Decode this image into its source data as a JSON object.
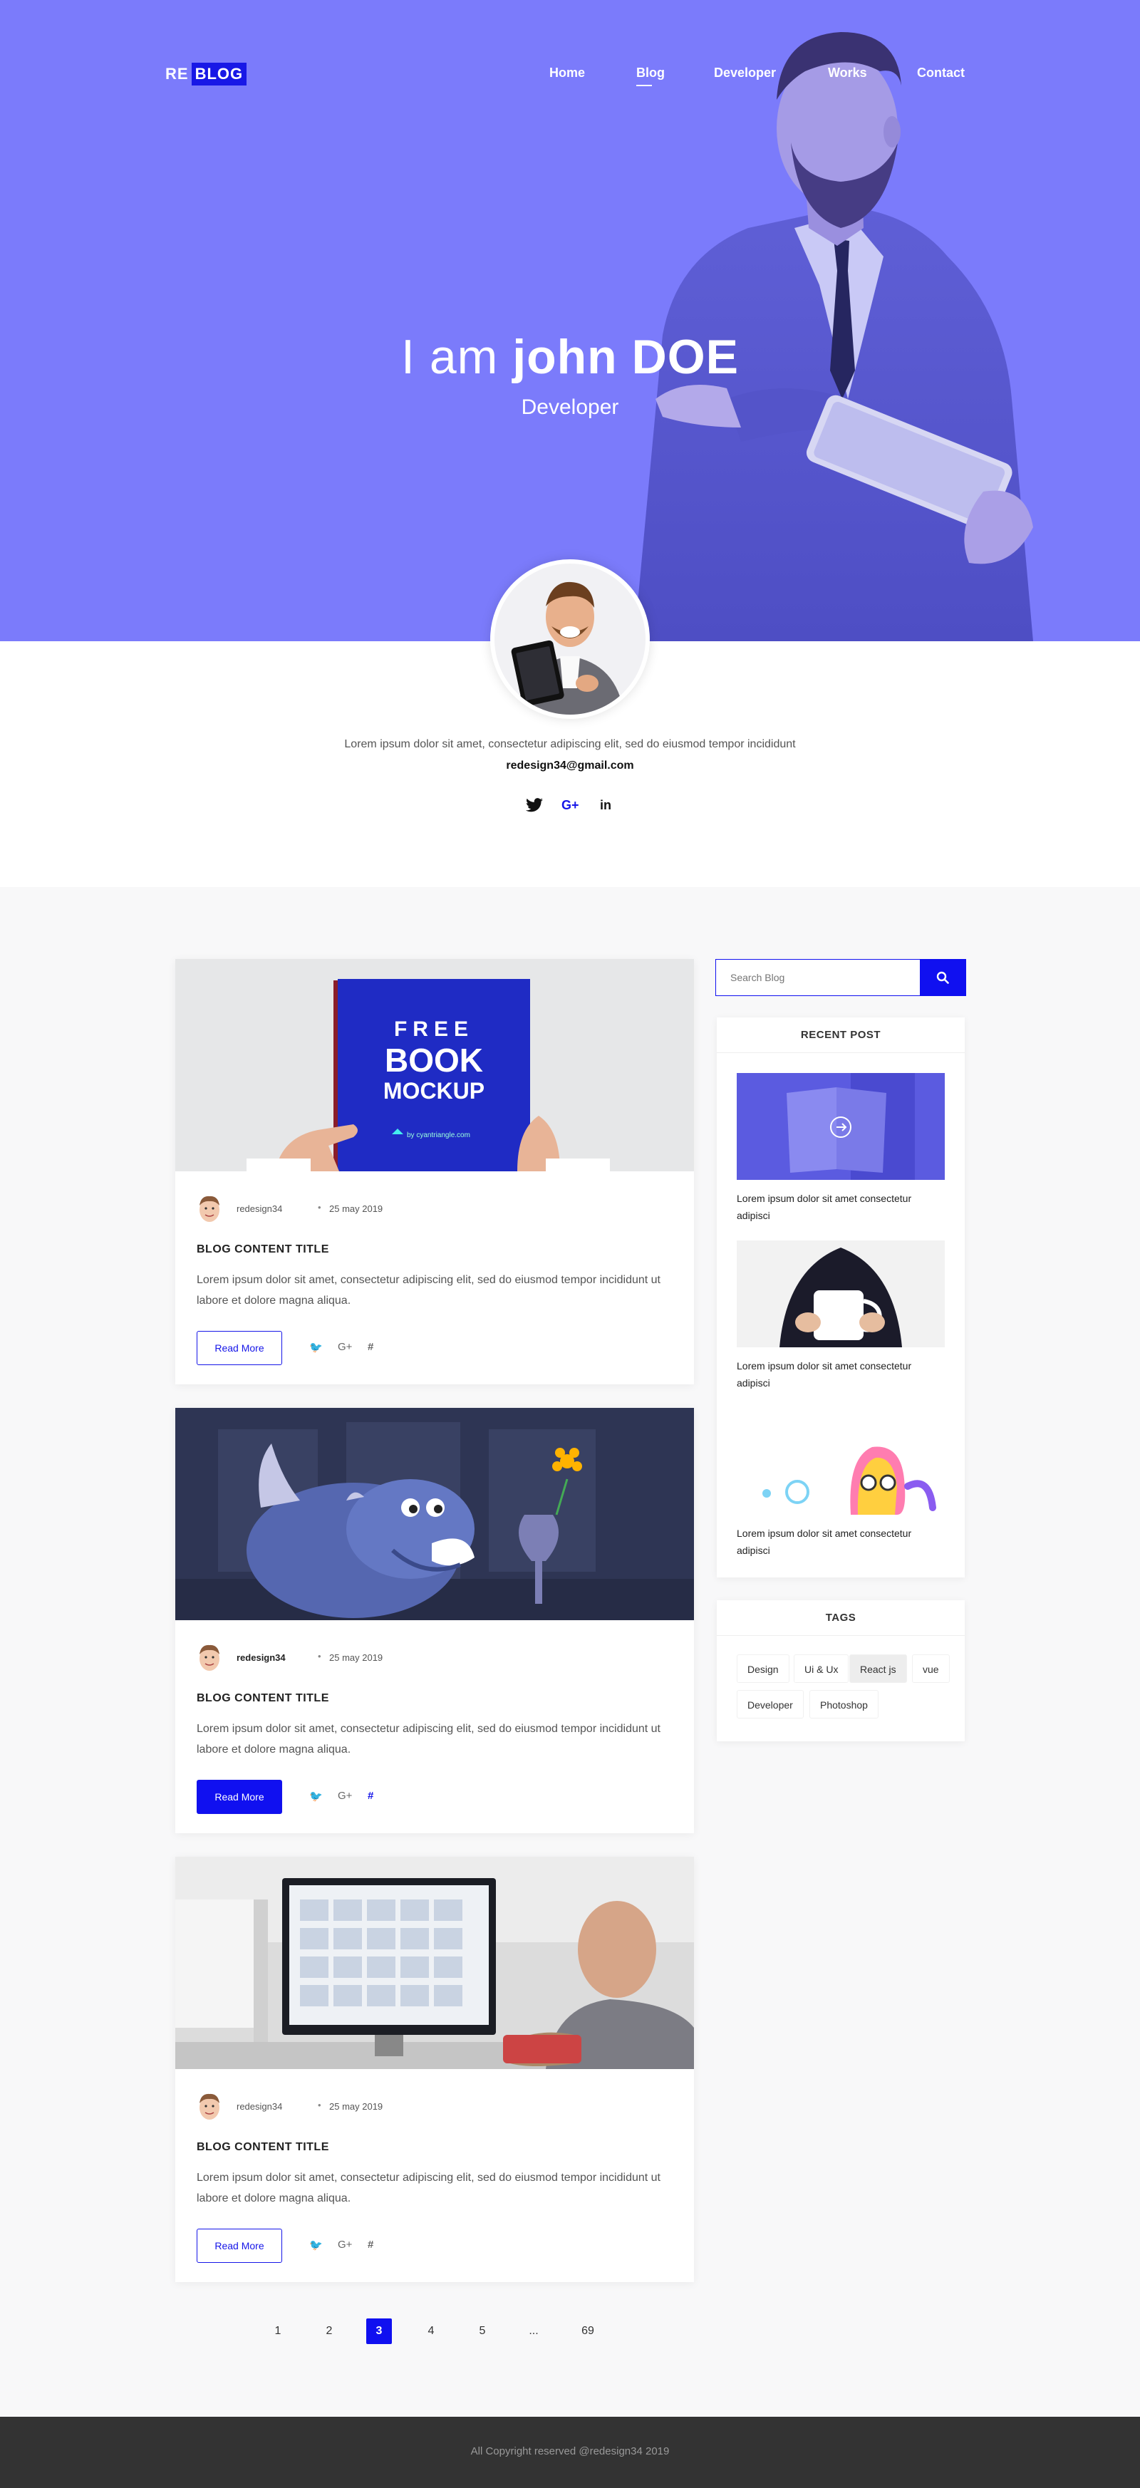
{
  "brand": {
    "logo_re": "RE",
    "logo_blog": "BLOG"
  },
  "nav": {
    "items": [
      {
        "label": "Home",
        "active": false
      },
      {
        "label": "Blog",
        "active": true
      },
      {
        "label": "Developer",
        "active": false
      },
      {
        "label": "Works",
        "active": false
      },
      {
        "label": "Contact",
        "active": false
      }
    ]
  },
  "hero": {
    "prefix": "I am ",
    "name": "john DOE",
    "role": "Developer",
    "bg_color": "#7b7bfb"
  },
  "profile": {
    "bio": "Lorem ipsum dolor sit amet, consectetur adipiscing elit, sed do eiusmod tempor incididunt",
    "email": "redesign34@gmail.com",
    "socials": [
      {
        "icon": "twitter-icon",
        "glyph": "🐦"
      },
      {
        "icon": "google-plus-icon",
        "glyph": "G+"
      },
      {
        "icon": "linkedin-icon",
        "glyph": "in"
      }
    ]
  },
  "posts": [
    {
      "image": "book-mockup",
      "book_text": {
        "line1": "FREE",
        "line2": "BOOK",
        "line3": "MOCKUP",
        "credit": "by cyantriangle.com"
      },
      "author": "redesign34",
      "author_bold": false,
      "date": "25 may 2019",
      "title": "BLOG CONTENT TITLE",
      "excerpt": "Lorem ipsum dolor sit amet, consectetur adipiscing elit, sed do eiusmod tempor incididunt ut labore et dolore magna aliqua.",
      "read_more": "Read More",
      "read_more_filled": false
    },
    {
      "image": "rhino-illustration",
      "author": "redesign34",
      "author_bold": true,
      "date": "25 may 2019",
      "title": "BLOG CONTENT TITLE",
      "excerpt": "Lorem ipsum dolor sit amet, consectetur adipiscing elit, sed do eiusmod tempor incididunt ut labore et dolore magna aliqua.",
      "read_more": "Read More",
      "read_more_filled": true
    },
    {
      "image": "developer-at-desk",
      "author": "redesign34",
      "author_bold": false,
      "date": "25 may 2019",
      "title": "BLOG CONTENT TITLE",
      "excerpt": "Lorem ipsum dolor sit amet, consectetur adipiscing elit, sed do eiusmod tempor incididunt ut labore et dolore magna aliqua.",
      "read_more": "Read More",
      "read_more_filled": false
    }
  ],
  "share": {
    "twitter": "🐦",
    "google": "G+",
    "slack": "#"
  },
  "sidebar": {
    "search": {
      "placeholder": "Search Blog",
      "value": "Search Blog"
    },
    "recent": {
      "title": "RECENT POST",
      "items": [
        {
          "image": "purple-book",
          "text": "Lorem ipsum dolor sit amet consectetur adipisci"
        },
        {
          "image": "coffee-mug",
          "text": "Lorem ipsum dolor sit amet consectetur adipisci"
        },
        {
          "image": "cute-monster",
          "text": "Lorem ipsum dolor sit amet consectetur adipisci"
        }
      ]
    },
    "tags": {
      "title": "TAGS",
      "items": [
        {
          "label": "Design",
          "selected": false
        },
        {
          "label": "Ui & Ux",
          "selected": false
        },
        {
          "label": "React js",
          "selected": true
        },
        {
          "label": "vue",
          "selected": false
        },
        {
          "label": "Developer",
          "selected": false
        },
        {
          "label": "Photoshop",
          "selected": false
        }
      ]
    }
  },
  "pagination": {
    "pages": [
      "1",
      "2",
      "3",
      "4",
      "5",
      "...",
      "69"
    ],
    "current": "3"
  },
  "footer": {
    "copyright": "All Copyright reserved @redesign34 2019"
  },
  "colors": {
    "accent": "#1010f0",
    "hero": "#7b7bfb",
    "footer": "#333333"
  }
}
